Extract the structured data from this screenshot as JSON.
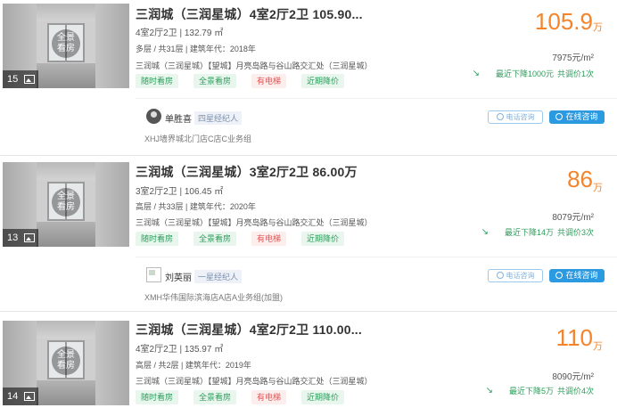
{
  "listings": [
    {
      "photo_count": "15",
      "pano_label": [
        "全景",
        "看房"
      ],
      "title": "三润城（三润星城）4室2厅2卫 105.90...",
      "layout": "4室2厅2卫 | 132.79 ㎡",
      "floor": "多层 / 共31层 | 建筑年代：2018年",
      "address": "三润城（三润星城）【望城】月亮岛路与谷山路交汇处（三润星城）",
      "tags": [
        "随时看房",
        "全景看房",
        "有电梯",
        "近期降价"
      ],
      "price": "105.9",
      "price_unit": "万",
      "unit_price": "7975元/m²",
      "drop_text": "最近下降1000元",
      "adjust_text": "共调价1次",
      "agent": {
        "name": "单胜喜",
        "badge": "四星经纪人",
        "phone_label": "电话咨询",
        "chat_label": "在线咨询",
        "store": "XHJ墙界城北门店C店C业务组"
      }
    },
    {
      "photo_count": "13",
      "pano_label": [
        "全景",
        "看房"
      ],
      "title": "三润城（三润星城）3室2厅2卫 86.00万",
      "layout": "3室2厅2卫 | 106.45 ㎡",
      "floor": "高层 / 共33层 | 建筑年代：2020年",
      "address": "三润城（三润星城）【望城】月亮岛路与谷山路交汇处（三润星城）",
      "tags": [
        "随时看房",
        "全景看房",
        "有电梯",
        "近期降价"
      ],
      "price": "86",
      "price_unit": "万",
      "unit_price": "8079元/m²",
      "drop_text": "最近下降14万",
      "adjust_text": "共调价3次",
      "agent": {
        "name": "刘英丽",
        "badge": "一星经纪人",
        "phone_label": "电话咨询",
        "chat_label": "在线咨询",
        "store": "XMH华伟国际滨海店A店A业务组(加盟)"
      }
    },
    {
      "photo_count": "14",
      "pano_label": [
        "全景",
        "看房"
      ],
      "title": "三润城（三润星城）4室2厅2卫 110.00...",
      "layout": "4室2厅2卫 | 135.97 ㎡",
      "floor": "高层 / 共2层 | 建筑年代：2019年",
      "address": "三润城（三润星城）【望城】月亮岛路与谷山路交汇处（三润星城）",
      "tags": [
        "随时看房",
        "全景看房",
        "有电梯",
        "近期降价"
      ],
      "price": "110",
      "price_unit": "万",
      "unit_price": "8090元/m²",
      "drop_text": "最近下降5万",
      "adjust_text": "共调价4次"
    }
  ],
  "colors": {
    "price": "#f3842b",
    "green_tag": "#2d9d5b",
    "red_tag": "#e25555",
    "chat_button": "#2b9ae0"
  }
}
